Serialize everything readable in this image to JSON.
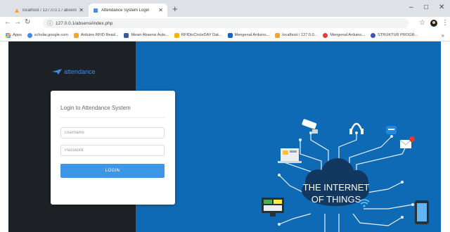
{
  "browser": {
    "tabs": [
      {
        "title": "localhost / 127.0.0.1 / absensi | ...",
        "active": false
      },
      {
        "title": "Attendance System Login",
        "active": true
      }
    ],
    "new_tab": "+",
    "window_controls": {
      "minimize": "–",
      "maximize": "□",
      "close": "✕"
    },
    "address": "127.0.0.1/absensi/index.php",
    "bookmarks": [
      {
        "label": "Apps",
        "color": "#4285f4"
      },
      {
        "label": "scholar.google.com",
        "color": "#4285f4"
      },
      {
        "label": "Arduino RFID Read...",
        "color": "#f5a623"
      },
      {
        "label": "Mesin Absensi Auto...",
        "color": "#3b5998"
      },
      {
        "label": "RFIDinCircleDAY Dat...",
        "color": "#f4b400"
      },
      {
        "label": "Mengenal Arduino...",
        "color": "#1565c0"
      },
      {
        "label": "localhost / 127.0.0...",
        "color": "#f5a623"
      },
      {
        "label": "Mengenal Arduino...",
        "color": "#e53935"
      },
      {
        "label": "STRUKTUR PROGR...",
        "color": "#3f51b5"
      }
    ]
  },
  "page": {
    "brand": "attendance",
    "login_title": "Login to Attendance System",
    "username_placeholder": "Username",
    "password_placeholder": "Password",
    "login_button": "LOGIN",
    "iot_line1": "THE INTERNET",
    "iot_line2": "OF THINGS"
  },
  "colors": {
    "page_bg": "#0f6ab5",
    "panel_bg": "#1d2126",
    "button": "#3e97e6",
    "cloud": "#13385f"
  }
}
